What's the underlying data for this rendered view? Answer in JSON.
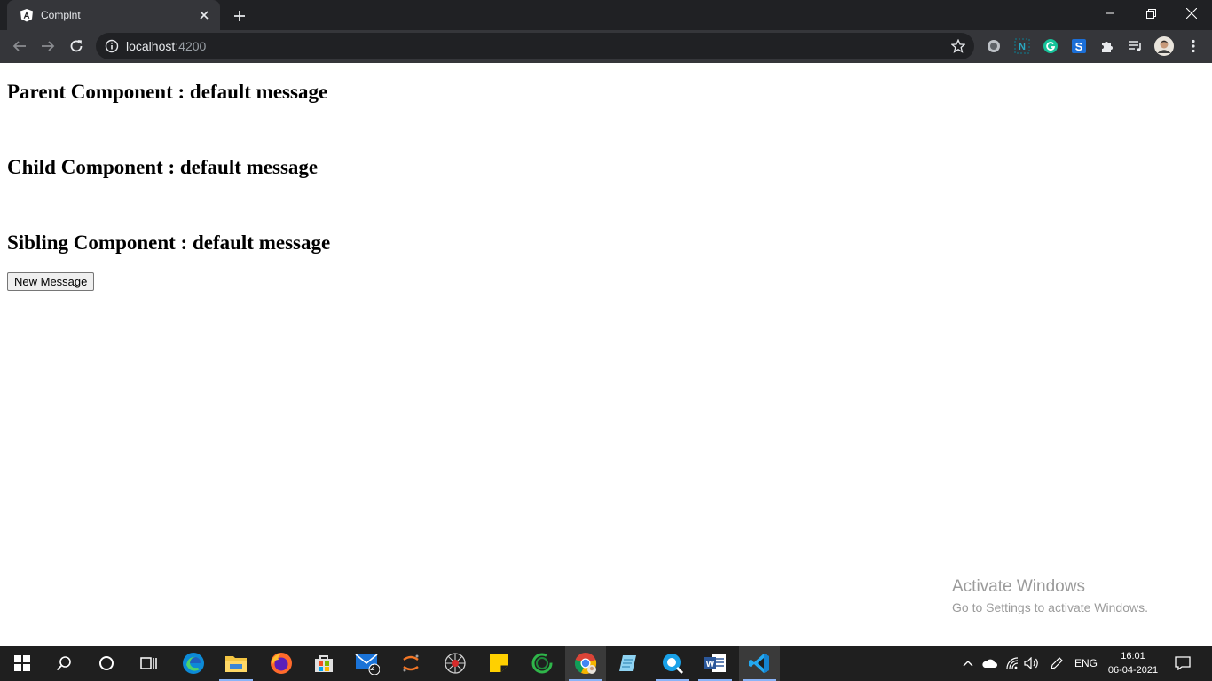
{
  "browser": {
    "tab": {
      "title": "Complnt",
      "favicon": "angular-logo-icon"
    },
    "address": {
      "host": "localhost",
      "port": ":4200"
    },
    "window_controls": [
      "minimize-icon",
      "restore-icon",
      "close-icon"
    ],
    "extensions": [
      "record-icon",
      "notion-icon",
      "grammarly-icon",
      "s-extension-icon",
      "puzzle-icon",
      "media-queue-icon",
      "profile-avatar",
      "menu-dots-icon"
    ]
  },
  "page": {
    "parent_heading": "Parent Component : default message",
    "child_heading": "Child Component : default message",
    "sibling_heading": "Sibling Component : default message",
    "button_label": "New Message"
  },
  "watermark": {
    "title": "Activate Windows",
    "subtitle": "Go to Settings to activate Windows."
  },
  "taskbar": {
    "apps": [
      "start-icon",
      "search-icon",
      "cortana-icon",
      "task-view-icon",
      "edge-icon",
      "file-explorer-icon",
      "firefox-icon",
      "store-icon",
      "mail-icon",
      "jupyter-icon",
      "spider-app-icon",
      "sticky-notes-icon",
      "refresh-app-icon",
      "chrome-icon",
      "notepad-icon",
      "maps-icon",
      "word-icon",
      "vscode-icon"
    ],
    "mail_badge": "2",
    "language": "ENG",
    "time": "16:01",
    "date": "06-04-2021"
  },
  "colors": {
    "tabstrip": "#202124",
    "toolbar": "#35363a",
    "taskbar": "#1f1f1f",
    "accent": "#8ab4f8"
  }
}
